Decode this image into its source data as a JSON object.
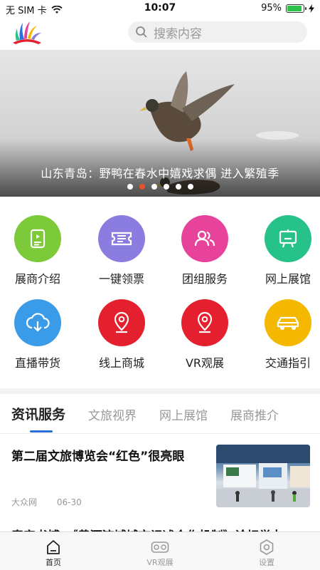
{
  "status_bar": {
    "carrier": "无 SIM 卡",
    "time": "10:07",
    "battery": "95%",
    "battery_level": 0.95
  },
  "header": {
    "search_placeholder": "搜索内容"
  },
  "banner": {
    "caption": "山东青岛：野鸭在春水中嬉戏求偶 进入繁殖季",
    "dot_count": 6,
    "active_dot": 1
  },
  "services": [
    {
      "label": "展商介绍",
      "color": "#7cc93a",
      "icon": "exhibitor-icon"
    },
    {
      "label": "一键领票",
      "color": "#8b7de0",
      "icon": "ticket-icon"
    },
    {
      "label": "团组服务",
      "color": "#e8439b",
      "icon": "group-icon"
    },
    {
      "label": "网上展馆",
      "color": "#27c28a",
      "icon": "easel-icon"
    },
    {
      "label": "直播带货",
      "color": "#3a9be8",
      "icon": "cloud-download-icon"
    },
    {
      "label": "线上商城",
      "color": "#e5202e",
      "icon": "location-pin-icon"
    },
    {
      "label": "VR观展",
      "color": "#e5202e",
      "icon": "location-pin-icon"
    },
    {
      "label": "交通指引",
      "color": "#f5b800",
      "icon": "car-icon"
    }
  ],
  "tabs": [
    "资讯服务",
    "文旅视界",
    "网上展馆",
    "展商推介"
  ],
  "news": [
    {
      "title": "第二届文旅博览会“红色”很亮眼",
      "source": "大众网",
      "date": "06-30"
    },
    {
      "title": "泰安书博：《黄河流域城市记述合作机制》论坛举办"
    }
  ],
  "tabbar": [
    {
      "label": "首页",
      "icon": "home-icon"
    },
    {
      "label": "VR观展",
      "icon": "vr-headset-icon"
    },
    {
      "label": "设置",
      "icon": "gear-icon"
    }
  ],
  "colors": {
    "accent": "#2a6fdc",
    "active_dot": "#e8502a"
  }
}
